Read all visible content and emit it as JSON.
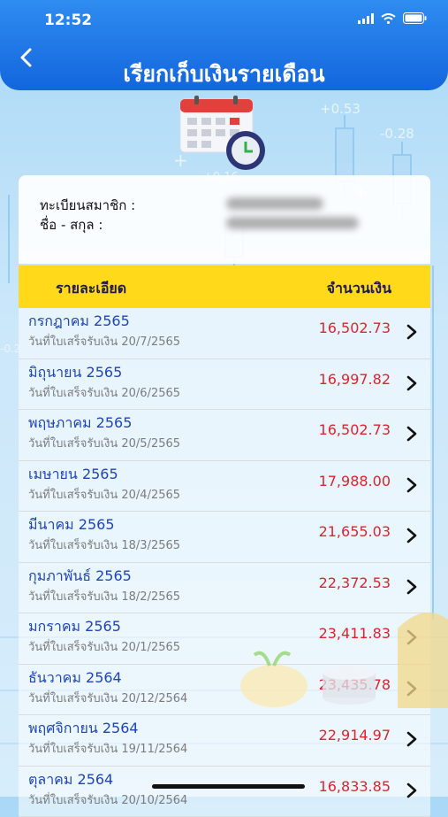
{
  "status_bar": {
    "time": "12:52"
  },
  "header": {
    "title": "เรียกเก็บเงินรายเดือน",
    "back_icon": "chevron-left-icon"
  },
  "background": {
    "tickers": [
      "+0.53",
      "-0.28",
      "+0.16",
      "-0.2"
    ]
  },
  "member_info": {
    "member_id_label": "ทะเบียนสมาชิก :",
    "name_label": "ชื่อ - สกุล :"
  },
  "table": {
    "header_detail": "รายละเอียด",
    "header_amount": "จำนวนเงิน",
    "rows": [
      {
        "month": "กรกฎาคม 2565",
        "date": "วันที่ใบเสร็จรับเงิน 20/7/2565",
        "amount": "16,502.73"
      },
      {
        "month": "มิถุนายน 2565",
        "date": "วันที่ใบเสร็จรับเงิน 20/6/2565",
        "amount": "16,997.82"
      },
      {
        "month": "พฤษภาคม 2565",
        "date": "วันที่ใบเสร็จรับเงิน 20/5/2565",
        "amount": "16,502.73"
      },
      {
        "month": "เมษายน 2565",
        "date": "วันที่ใบเสร็จรับเงิน 20/4/2565",
        "amount": "17,988.00"
      },
      {
        "month": "มีนาคม 2565",
        "date": "วันที่ใบเสร็จรับเงิน 18/3/2565",
        "amount": "21,655.03"
      },
      {
        "month": "กุมภาพันธ์ 2565",
        "date": "วันที่ใบเสร็จรับเงิน 18/2/2565",
        "amount": "22,372.53"
      },
      {
        "month": "มกราคม 2565",
        "date": "วันที่ใบเสร็จรับเงิน 20/1/2565",
        "amount": "23,411.83"
      },
      {
        "month": "ธันวาคม 2564",
        "date": "วันที่ใบเสร็จรับเงิน 20/12/2564",
        "amount": "23,435.78"
      },
      {
        "month": "พฤศจิกายน 2564",
        "date": "วันที่ใบเสร็จรับเงิน 19/11/2564",
        "amount": "22,914.97"
      },
      {
        "month": "ตุลาคม 2564",
        "date": "วันที่ใบเสร็จรับเงิน 20/10/2564",
        "amount": "16,833.85"
      }
    ]
  },
  "colors": {
    "header": "#1e74e6",
    "table_header": "#ffd91a",
    "month_text": "#1f45b8",
    "amount_text": "#e0232d"
  }
}
